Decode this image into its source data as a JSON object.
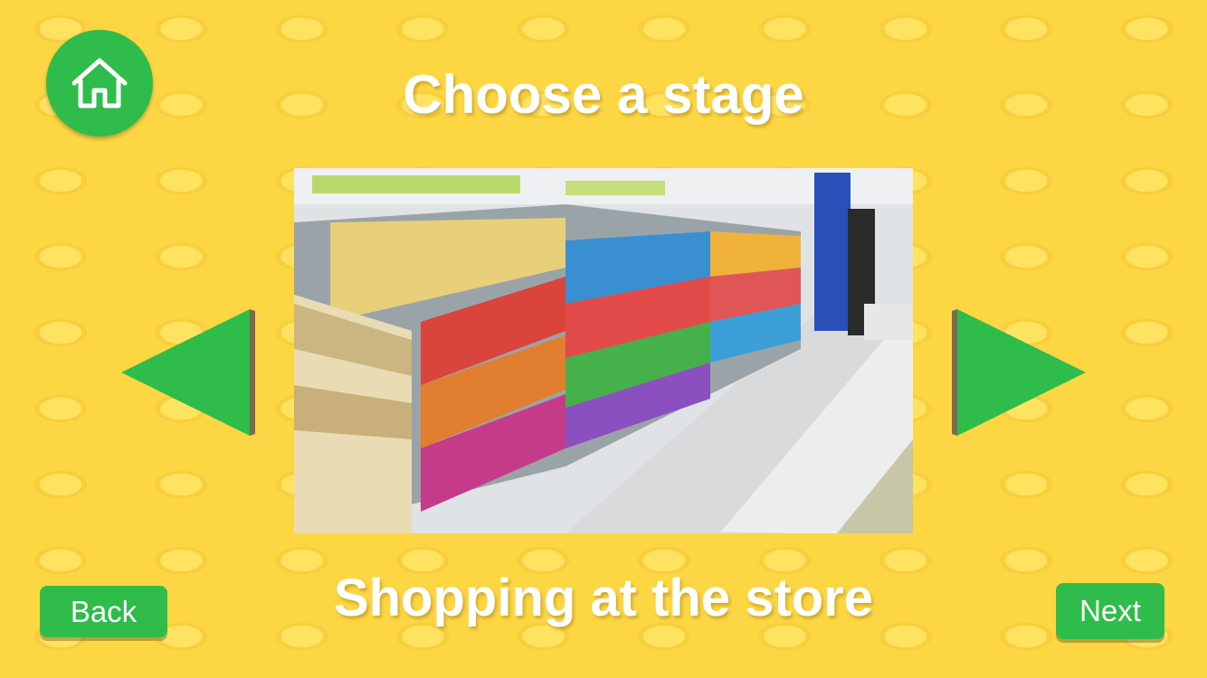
{
  "header": {
    "title": "Choose a stage"
  },
  "nav": {
    "home_icon": "home-icon",
    "prev_icon": "triangle-left-icon",
    "next_icon": "triangle-right-icon"
  },
  "stage": {
    "caption": "Shopping at the store",
    "picture": "convenience-store-aisle-photo"
  },
  "footer": {
    "back_label": "Back",
    "next_label": "Next"
  },
  "colors": {
    "background": "#fdd643",
    "accent_green": "#2fbc4b",
    "text": "#ffffff"
  }
}
